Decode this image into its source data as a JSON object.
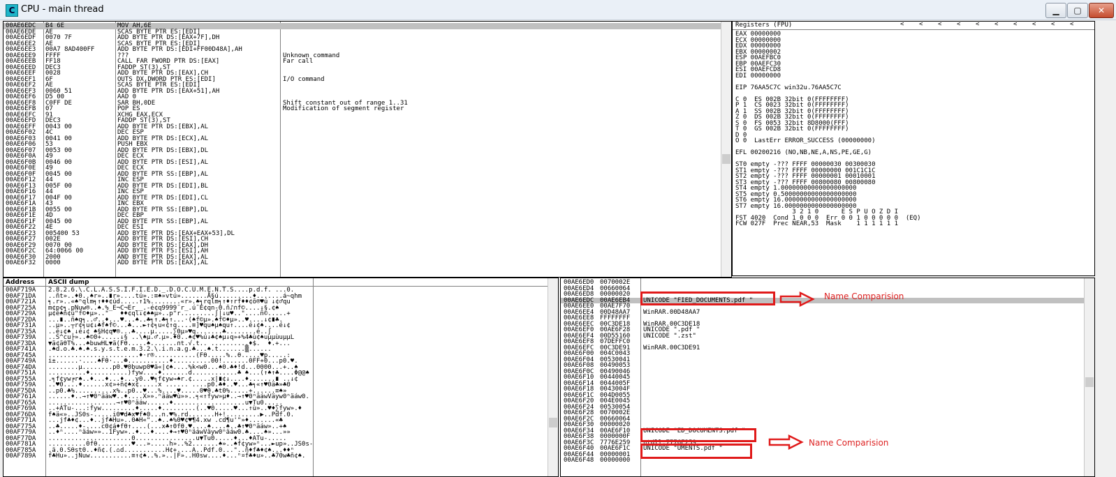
{
  "window": {
    "title": "CPU - main thread",
    "icon_letter": "C",
    "buttons": {
      "minimize": "▁",
      "maximize": "▢",
      "close": "✕"
    }
  },
  "disassembly": {
    "rows": [
      {
        "addr": "00AE6EDC",
        "hex": "B4 6E",
        "asm": "MOV AH,6E",
        "cmt": ""
      },
      {
        "addr": "00AE6EDE",
        "hex": "AE",
        "asm": "SCAS BYTE PTR ES:[EDI]",
        "cmt": ""
      },
      {
        "addr": "00AE6EDF",
        "hex": "0070 7F",
        "asm": "ADD BYTE PTR DS:[EAX+7F],DH",
        "cmt": ""
      },
      {
        "addr": "00AE6EE2",
        "hex": "AE",
        "asm": "SCAS BYTE PTR ES:[EDI]",
        "cmt": ""
      },
      {
        "addr": "00AE6EE3",
        "hex": "00A7 8AD400FF",
        "asm": "ADD BYTE PTR DS:[EDI+FF00D48A],AH",
        "cmt": ""
      },
      {
        "addr": "00AE6EE9",
        "hex": "FFFF",
        "asm": "???",
        "cmt": "Unknown command"
      },
      {
        "addr": "00AE6EEB",
        "hex": "FF18",
        "asm": "CALL FAR FWORD PTR DS:[EAX]",
        "cmt": "Far call"
      },
      {
        "addr": "00AE6EED",
        "hex": "DEC3",
        "asm": "FADDP ST(3),ST",
        "cmt": ""
      },
      {
        "addr": "00AE6EEF",
        "hex": "0028",
        "asm": "ADD BYTE PTR DS:[EAX],CH",
        "cmt": ""
      },
      {
        "addr": "00AE6EF1",
        "hex": "6F",
        "asm": "OUTS DX,DWORD PTR ES:[EDI]",
        "cmt": "I/O command"
      },
      {
        "addr": "00AE6EF2",
        "hex": "AE",
        "asm": "SCAS BYTE PTR ES:[EDI]",
        "cmt": ""
      },
      {
        "addr": "00AE6EF3",
        "hex": "0060 51",
        "asm": "ADD BYTE PTR DS:[EAX+51],AH",
        "cmt": ""
      },
      {
        "addr": "00AE6EF6",
        "hex": "D5 00",
        "asm": "AAD 0",
        "cmt": ""
      },
      {
        "addr": "00AE6EF8",
        "hex": "C0FF DE",
        "asm": "SAR BH,0DE",
        "cmt": "Shift constant out of range 1..31"
      },
      {
        "addr": "00AE6EFB",
        "hex": "07",
        "asm": "POP ES",
        "cmt": "Modification of segment register"
      },
      {
        "addr": "00AE6EFC",
        "hex": "91",
        "asm": "XCHG EAX,ECX",
        "cmt": ""
      },
      {
        "addr": "00AE6EFD",
        "hex": "DEC3",
        "asm": "FADDP ST(3),ST",
        "cmt": ""
      },
      {
        "addr": "00AE6EFF",
        "hex": "0043 00",
        "asm": "ADD BYTE PTR DS:[EBX],AL",
        "cmt": ""
      },
      {
        "addr": "00AE6F02",
        "hex": "4C",
        "asm": "DEC ESP",
        "cmt": ""
      },
      {
        "addr": "00AE6F03",
        "hex": "0041 00",
        "asm": "ADD BYTE PTR DS:[ECX],AL",
        "cmt": ""
      },
      {
        "addr": "00AE6F06",
        "hex": "53",
        "asm": "PUSH EBX",
        "cmt": ""
      },
      {
        "addr": "00AE6F07",
        "hex": "0053 00",
        "asm": "ADD BYTE PTR DS:[EBX],DL",
        "cmt": ""
      },
      {
        "addr": "00AE6F0A",
        "hex": "49",
        "asm": "DEC ECX",
        "cmt": ""
      },
      {
        "addr": "00AE6F0B",
        "hex": "0046 00",
        "asm": "ADD BYTE PTR DS:[ESI],AL",
        "cmt": ""
      },
      {
        "addr": "00AE6F0E",
        "hex": "49",
        "asm": "DEC ECX",
        "cmt": ""
      },
      {
        "addr": "00AE6F0F",
        "hex": "0045 00",
        "asm": "ADD BYTE PTR SS:[EBP],AL",
        "cmt": ""
      },
      {
        "addr": "00AE6F12",
        "hex": "44",
        "asm": "INC ESP",
        "cmt": ""
      },
      {
        "addr": "00AE6F13",
        "hex": "005F 00",
        "asm": "ADD BYTE PTR DS:[EDI],BL",
        "cmt": ""
      },
      {
        "addr": "00AE6F16",
        "hex": "44",
        "asm": "INC ESP",
        "cmt": ""
      },
      {
        "addr": "00AE6F17",
        "hex": "004F 00",
        "asm": "ADD BYTE PTR DS:[EDI],CL",
        "cmt": ""
      },
      {
        "addr": "00AE6F1A",
        "hex": "43",
        "asm": "INC EBX",
        "cmt": ""
      },
      {
        "addr": "00AE6F1B",
        "hex": "0055 00",
        "asm": "ADD BYTE PTR SS:[EBP],DL",
        "cmt": ""
      },
      {
        "addr": "00AE6F1E",
        "hex": "4D",
        "asm": "DEC EBP",
        "cmt": ""
      },
      {
        "addr": "00AE6F1F",
        "hex": "0045 00",
        "asm": "ADD BYTE PTR SS:[EBP],AL",
        "cmt": ""
      },
      {
        "addr": "00AE6F22",
        "hex": "4E",
        "asm": "DEC ESI",
        "cmt": ""
      },
      {
        "addr": "00AE6F23",
        "hex": "005400 53",
        "asm": "ADD BYTE PTR DS:[EAX+EAX+53],DL",
        "cmt": ""
      },
      {
        "addr": "00AE6F27",
        "hex": "002E",
        "asm": "ADD BYTE PTR DS:[ESI],CH",
        "cmt": ""
      },
      {
        "addr": "00AE6F29",
        "hex": "0070 00",
        "asm": "ADD BYTE PTR DS:[EAX],DH",
        "cmt": ""
      },
      {
        "addr": "00AE6F2C",
        "hex": "64:0066 00",
        "asm": "ADD BYTE PTR FS:[ESI],AH",
        "cmt": ""
      },
      {
        "addr": "00AE6F30",
        "hex": "2000",
        "asm": "AND BYTE PTR DS:[EAX],AL",
        "cmt": ""
      },
      {
        "addr": "00AE6F32",
        "hex": "0000",
        "asm": "ADD BYTE PTR DS:[EAX],AL",
        "cmt": ""
      }
    ]
  },
  "registers": {
    "title": "Registers (FPU)",
    "nav_arrows": [
      "<",
      "<",
      "<",
      "<",
      "<",
      "<",
      "<",
      "<",
      "<",
      "<"
    ],
    "lines": [
      "EAX 00000000",
      "ECX 00000000",
      "EDX 00000000",
      "EBX 00000002",
      "ESP 00AEFBC0",
      "EBP 00AEFC30",
      "ESI 00AEFCD8",
      "EDI 00000000",
      "",
      "EIP 76AA5C7C win32u.76AA5C7C",
      "",
      "C 0  ES 002B 32bit 0(FFFFFFFF)",
      "P 1  CS 0023 32bit 0(FFFFFFFF)",
      "A 1  SS 002B 32bit 0(FFFFFFFF)",
      "Z 0  DS 002B 32bit 0(FFFFFFFF)",
      "S 0  FS 0053 32bit 8D8000(FFF)",
      "T 0  GS 002B 32bit 0(FFFFFFFF)",
      "D 0",
      "O 0  LastErr ERROR_SUCCESS (00000000)",
      "",
      "EFL 00200216 (NO,NB,NE,A,NS,PE,GE,G)",
      "",
      "ST0 empty -??? FFFF 00000030 00300030",
      "ST1 empty -??? FFFF 00000000 001C1C1C",
      "ST2 empty -??? FFFF 00000001 00010001",
      "ST3 empty -??? FFFF 00800080 00800080",
      "ST4 empty 1.00000000000000000000",
      "ST5 empty 0.50000000000000000000",
      "ST6 empty 16.0000000000000000000",
      "ST7 empty 16.0000000000000000000",
      "               3 2 1 0      E S P U O Z D I",
      "FST 4020  Cond 1 0 0 0  Err 0 0 1 0 0 0 0 0  (EQ)",
      "FCW 027F  Prec NEAR,53  Mask    1 1 1 1 1 1"
    ]
  },
  "dump": {
    "header_address": "Address",
    "header_ascii": "ASCII dump",
    "rows": [
      {
        "addr": "00AF719A",
        "ascii": "2.8.2.6.\\.C.L.A.S.S.I.F.I.E.D._.D.O.C.U.M.E.N.T.S....p.d.f. ...0."
      },
      {
        "addr": "00AF71DA",
        "ascii": "..ñt»..♦0..♠r»..∎r»....tú».:≡♠»vtú».......Å§ú.........♦.......á~qhm"
      },
      {
        "addr": "00AF721A",
        "ascii": "╕.r»..«♠ⁿqlm╕↑♦♦¢úd.....↑1%........«r».♠╕rqlm╕↑♦↑rf♦♦¢õ®♥ú ↓¢♂qu"
      },
      {
        "addr": "00AF725A",
        "ascii": "m¢p¢╕.pNuw®..♠.%_E¬C¬Er__.-é¢q9999¯r_.ú¯É¢qn-Θ.ñ♪∩f©....↓§.¢♠"
      },
      {
        "addr": "00AF729A",
        "ascii": "µ¢é♠ñ¢ú\"f©♦µ»..\"   ♦♦¢ql↓¢♠♠µ»..p\"r.........∫|↓u♥..\"....ñ©.....+"
      },
      {
        "addr": "00AF72DA",
        "ascii": "...∎..ñ♠q╕..♂..♦...♥...♠..♣╕↑.♣╕↑...·(♠f©µ».♠f©♦µ»..♥....↓¢∎♣."
      },
      {
        "addr": "00AF731A",
        "ascii": "..µ»..┬r¢╕u¢↓♣f♠f©...♣...►↑¢╕u«¢↑q....≡]♥qu♠µ♠qu↑....é↓¢♠....é↓¢"
      },
      {
        "addr": "00AF735A",
        "ascii": "..é↓¢♠ ↓é↓¢ ♠§H¢q♥®...♣....µ.....∑0µ»♥q.......♣........é..∫"
      },
      {
        "addr": "00AF739A",
        "ascii": "..S^cu├»..♠©0+.....↓§ ..\\♠µ.♂.µ».♦0..♠¢♥%ú↓♣¢♠µ↓q»+%4♣ù¢♠uµµùuµµL"
      },
      {
        "addr": "00AF73DA",
        "ascii": "▼ä¢äθT%...♠buwHL▼ä(Fθ.....♠.......∩t.√.t.. ..........♦$.  ♦.+..."
      },
      {
        "addr": "00AF741A",
        "ascii": ".♠d.o.♣.♠.♠.s.y.s.t.e.m.3.2.\\.i.n.a.g.♣...♠.t.......▒......"
      },
      {
        "addr": "00AF745A",
        "ascii": "........................♦·r®...........(Fθ.....%..θ.....♥p.....:"
      },
      {
        "addr": "00AF749A",
        "ascii": "i±......·....♠Fθ·...☻...........♦..........00!.......0FF+0...p0.♥."
      },
      {
        "addr": "00AF74DA",
        "ascii": "........µ........p0.♥0buwp0♥ä«|¢♠....%k<w0...♠0.♣♦!d...0000...+..♠"
      },
      {
        "addr": "00AF751A",
        "ascii": "..........♦..........)fyw....♦.......d............♣ ♠...(↑♠↑♣....Φ@@♠"
      },
      {
        "addr": "00AF755A",
        "ascii": ".╕f¢yw╒r♠..♦...♦...♦...y0..♥╕f¢yw→♠r.¢.....x|∎¢↓....♦.......∎ ..↓¢"
      },
      {
        "addr": "00AF759A",
        "ascii": "..♥0....♦......x¢»+ñ¢♠x¢.....x ...... ....p0.♣♦..♥...♣╕«↑♥0ä♣»♣Θ"
      },
      {
        "addr": "00AF75DA",
        "ascii": "..p0.♣%..........x%..p0..♥...%....♥.....0♥θ.♣t0%.....+......≡♠»"
      },
      {
        "addr": "00AF761A",
        "ascii": "......♦..→↑♥0ⁿäáw♥..♦....X»».ⁿäáw♥ù»»..╕«↑fyw»µ♦..→↑♥0ⁿäáwVäyw0ⁿäáw0."
      },
      {
        "addr": "00AF765A",
        "ascii": "..................→↑♥0ⁿäáw......♦...................u▼Tu0....."
      },
      {
        "addr": "00AF769A",
        "ascii": "..+ATu-...:fyw.........♦.....♦.........(..♥0.....♥...↑ù»..♥♦∑fyw».♦"
      },
      {
        "addr": "00AF76DA",
        "ascii": "f♠ä«»..JS0s-.....i0♥d♣x♥f♠0...n.♥%.rd.......H+!.........▶..Pdf.0."
      },
      {
        "addr": "00AF771A",
        "ascii": "...jf♣♦¢...♦..jf♣Hu»..0♣H«\"..♠..♠%0♥¢♥¶4.xw .cd¶u'\"»♦.......«♣"
      },
      {
        "addr": "00AF775A",
        "ascii": "..♣.....♦-....c0¢á♦fθ↑....(...x♣↑0fθ.♥....♠....♠..♣↑♥0ⁿäáw»..+♠"
      },
      {
        "addr": "00AF779A",
        "ascii": "..♦ⁿ....ⁿäáw»»..1Fyw»..♦...♦....♦→↑♥0ⁿäáwVäyw0ⁿäáw0.♣....♠»...»»"
      },
      {
        "addr": "00AF77DA",
        "ascii": "......................0................u▼Tu0.....♦...♦ATu-....."
      },
      {
        "addr": "00AF781A",
        "ascii": "..........0fθ.........♥...».....h»..%2.......♠»..♠f¢yw»ⁿ...►up»..JS0s-"
      },
      {
        "addr": "00AF785A",
        "ascii": ".ä.0.Sθst0..♦ñ¢.(.⌂d...........H¢+....A..Pdf.0...\"..ñ♦f♣♦¢♠...♦♦ⁿ"
      },
      {
        "addr": "00AF789A",
        "ascii": "f♣Hu»..jNuw...........≡↑¢♠..%.»..|F»..H0sw....♦...ⁿ¤f♣♦u»..♣70w♣ñ¢♠."
      }
    ]
  },
  "stack": {
    "rows": [
      {
        "addr": "00AE6ED0",
        "val": "0070002E",
        "cmt": ""
      },
      {
        "addr": "00AE6ED4",
        "val": "00660064",
        "cmt": ""
      },
      {
        "addr": "00AE6ED8",
        "val": "00000020",
        "cmt": ""
      },
      {
        "addr": "00AE6EDC",
        "val": "00AE6EB4",
        "cmt": "UNICODE \"FIED_DOCUMENTS.pdf \"",
        "sel": true
      },
      {
        "addr": "00AE6EE0",
        "val": "00AE7F70",
        "cmt": ""
      },
      {
        "addr": "00AE6EE4",
        "val": "00D48AA7",
        "cmt": "WinRAR.00D48AA7"
      },
      {
        "addr": "00AE6EE8",
        "val": "FFFFFFFF",
        "cmt": ""
      },
      {
        "addr": "00AE6EEC",
        "val": "00C3DE18",
        "cmt": "WinRAR.00C3DE18"
      },
      {
        "addr": "00AE6EF0",
        "val": "00AE6F28",
        "cmt": "UNICODE \".pdf \""
      },
      {
        "addr": "00AE6EF4",
        "val": "00D55160",
        "cmt": "UNICODE \".zst\""
      },
      {
        "addr": "00AE6EF8",
        "val": "07DEFFC0",
        "cmt": ""
      },
      {
        "addr": "00AE6EFC",
        "val": "00C3DE91",
        "cmt": "WinRAR.00C3DE91"
      },
      {
        "addr": "00AE6F00",
        "val": "004C0043",
        "cmt": ""
      },
      {
        "addr": "00AE6F04",
        "val": "00530041",
        "cmt": ""
      },
      {
        "addr": "00AE6F08",
        "val": "00490053",
        "cmt": ""
      },
      {
        "addr": "00AE6F0C",
        "val": "00490046",
        "cmt": ""
      },
      {
        "addr": "00AE6F10",
        "val": "00440045",
        "cmt": ""
      },
      {
        "addr": "00AE6F14",
        "val": "0044005F",
        "cmt": ""
      },
      {
        "addr": "00AE6F18",
        "val": "0043004F",
        "cmt": ""
      },
      {
        "addr": "00AE6F1C",
        "val": "004D0055",
        "cmt": ""
      },
      {
        "addr": "00AE6F20",
        "val": "004E0045",
        "cmt": ""
      },
      {
        "addr": "00AE6F24",
        "val": "00530054",
        "cmt": ""
      },
      {
        "addr": "00AE6F28",
        "val": "0070002E",
        "cmt": ""
      },
      {
        "addr": "00AE6F2C",
        "val": "00660064",
        "cmt": ""
      },
      {
        "addr": "00AE6F30",
        "val": "00000020",
        "cmt": ""
      },
      {
        "addr": "00AE6F34",
        "val": "00AE6F10",
        "cmt": "UNICODE \"ED_DOCUMENTS.pdf \""
      },
      {
        "addr": "00AE6F38",
        "val": "0000000F",
        "cmt": ""
      },
      {
        "addr": "00AE6F3C",
        "val": "7776E259",
        "cmt": "ntdll.7776E259"
      },
      {
        "addr": "00AE6F40",
        "val": "00AE6F1C",
        "cmt": "UNICODE \"UMENTS.pdf \""
      },
      {
        "addr": "00AE6F44",
        "val": "00000001",
        "cmt": ""
      },
      {
        "addr": "00AE6F48",
        "val": "00000000",
        "cmt": ""
      }
    ]
  },
  "annotations": {
    "label_1": "Name Comparision",
    "label_2": "Name Comparision",
    "color": "#e01a1a"
  }
}
